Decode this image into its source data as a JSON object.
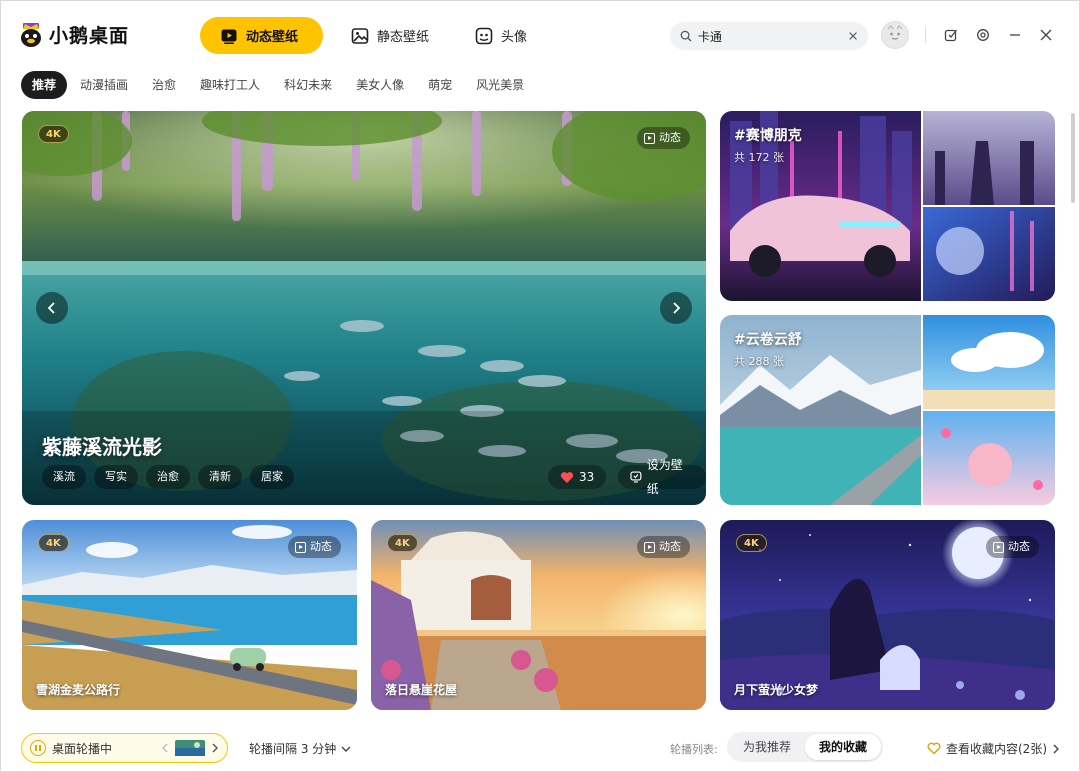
{
  "app": {
    "name": "小鹅桌面"
  },
  "main_tabs": [
    {
      "label": "动态壁纸",
      "icon": "video-icon",
      "active": true
    },
    {
      "label": "静态壁纸",
      "icon": "image-icon",
      "active": false
    },
    {
      "label": "头像",
      "icon": "avatar-icon",
      "active": false
    }
  ],
  "search": {
    "value": "卡通",
    "placeholder": ""
  },
  "categories": [
    "推荐",
    "动漫插画",
    "治愈",
    "趣味打工人",
    "科幻未来",
    "美女人像",
    "萌宠",
    "风光美景"
  ],
  "active_category": "推荐",
  "hero": {
    "badge": "4K",
    "type_label": "动态",
    "title": "紫藤溪流光影",
    "tags": [
      "溪流",
      "写实",
      "治愈",
      "清新",
      "居家"
    ],
    "likes": "33",
    "set_wallpaper": "设为壁纸"
  },
  "albums": [
    {
      "title": "#赛博朋克",
      "count": "共 172 张"
    },
    {
      "title": "#云卷云舒",
      "count": "共 288 张"
    }
  ],
  "cards": [
    {
      "badge": "4K",
      "type_label": "动态",
      "title": "雪湖金麦公路行"
    },
    {
      "badge": "4K",
      "type_label": "动态",
      "title": "落日悬崖花屋"
    },
    {
      "badge": "4K",
      "type_label": "动态",
      "title": "月下萤光少女梦"
    }
  ],
  "bottom": {
    "carousel_label": "桌面轮播中",
    "interval": "轮播间隔 3 分钟",
    "rotation_list_label": "轮播列表:",
    "seg_options": [
      "为我推荐",
      "我的收藏"
    ],
    "seg_active": "我的收藏",
    "fav_link": "查看收藏内容(2张)"
  },
  "colors": {
    "accent": "#ffc400",
    "dark_pill": "#1d1d1f"
  }
}
